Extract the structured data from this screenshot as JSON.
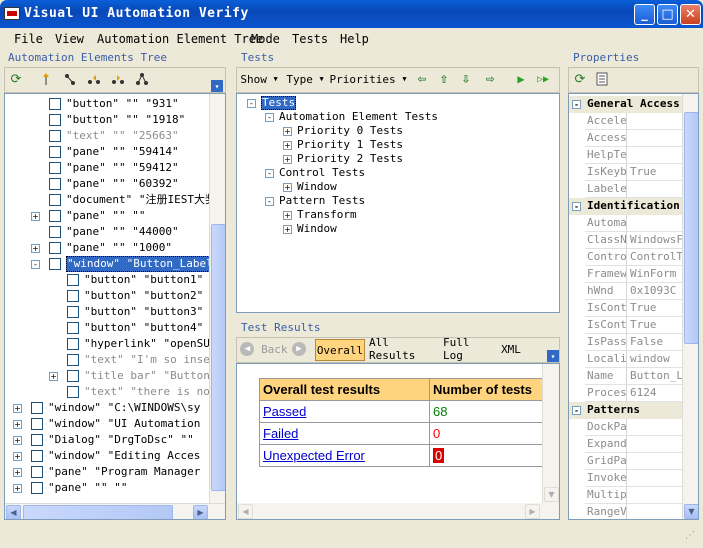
{
  "window": {
    "title": "Visual UI Automation Verify",
    "min": "_",
    "max": "□",
    "close": "✕"
  },
  "menu": [
    "File",
    "View",
    "Automation Element Tree",
    "Mode",
    "Tests",
    "Help"
  ],
  "tree_pane": {
    "title": "Automation Elements Tree",
    "rows": [
      {
        "text": "\"button\" \"\" \"931\"",
        "indent": 1,
        "expander": "",
        "gray": false,
        "selected": false
      },
      {
        "text": "\"button\" \"\" \"1918\"",
        "indent": 1,
        "expander": "",
        "gray": false,
        "selected": false
      },
      {
        "text": "\"text\" \"\" \"25663\"",
        "indent": 1,
        "expander": "",
        "gray": true,
        "selected": false
      },
      {
        "text": "\"pane\" \"\" \"59414\"",
        "indent": 1,
        "expander": "",
        "gray": false,
        "selected": false
      },
      {
        "text": "\"pane\" \"\" \"59412\"",
        "indent": 1,
        "expander": "",
        "gray": false,
        "selected": false
      },
      {
        "text": "\"pane\" \"\" \"60392\"",
        "indent": 1,
        "expander": "",
        "gray": false,
        "selected": false
      },
      {
        "text": "\"document\" \"注册IEST大奖",
        "indent": 1,
        "expander": "",
        "gray": false,
        "selected": false
      },
      {
        "text": "\"pane\" \"\" \"\"",
        "indent": 1,
        "expander": "+",
        "gray": false,
        "selected": false
      },
      {
        "text": "\"pane\" \"\" \"44000\"",
        "indent": 1,
        "expander": "",
        "gray": false,
        "selected": false
      },
      {
        "text": "\"pane\" \"\" \"1000\"",
        "indent": 1,
        "expander": "+",
        "gray": false,
        "selected": false
      },
      {
        "text": "\"window\" \"Button_Label_",
        "indent": 1,
        "expander": "-",
        "gray": false,
        "selected": true
      },
      {
        "text": "\"button\" \"button1\" \"",
        "indent": 2,
        "expander": "",
        "gray": false,
        "selected": false
      },
      {
        "text": "\"button\" \"button2\" \"",
        "indent": 2,
        "expander": "",
        "gray": false,
        "selected": false
      },
      {
        "text": "\"button\" \"button3\" \"",
        "indent": 2,
        "expander": "",
        "gray": false,
        "selected": false
      },
      {
        "text": "\"button\" \"button4\" \"",
        "indent": 2,
        "expander": "",
        "gray": false,
        "selected": false
      },
      {
        "text": "\"hyperlink\" \"openSUS",
        "indent": 2,
        "expander": "",
        "gray": false,
        "selected": false
      },
      {
        "text": "\"text\" \"I'm so insen",
        "indent": 2,
        "expander": "",
        "gray": true,
        "selected": false
      },
      {
        "text": "\"title bar\" \"Button_",
        "indent": 2,
        "expander": "+",
        "gray": true,
        "selected": false
      },
      {
        "text": "\"text\" \"there is not",
        "indent": 2,
        "expander": "",
        "gray": true,
        "selected": false
      },
      {
        "text": "\"window\" \"C:\\WINDOWS\\sy",
        "indent": 0,
        "expander": "+",
        "gray": false,
        "selected": false
      },
      {
        "text": "\"window\" \"UI Automation",
        "indent": 0,
        "expander": "+",
        "gray": false,
        "selected": false
      },
      {
        "text": "\"Dialog\" \"DrgToDsc\" \"\"",
        "indent": 0,
        "expander": "+",
        "gray": false,
        "selected": false
      },
      {
        "text": "\"window\" \"Editing Acces",
        "indent": 0,
        "expander": "+",
        "gray": false,
        "selected": false
      },
      {
        "text": "\"pane\" \"Program Manager",
        "indent": 0,
        "expander": "+",
        "gray": false,
        "selected": false
      },
      {
        "text": "\"pane\" \"\" \"\"",
        "indent": 0,
        "expander": "+",
        "gray": false,
        "selected": false
      }
    ]
  },
  "tests_pane": {
    "title": "Tests",
    "toolbar": {
      "show": "Show",
      "type": "Type",
      "priorities": "Priorities"
    },
    "tree": [
      {
        "label": "Tests",
        "level": 0,
        "expander": "-",
        "selected": true
      },
      {
        "label": "Automation Element Tests",
        "level": 1,
        "expander": "-",
        "selected": false
      },
      {
        "label": "Priority 0 Tests",
        "level": 2,
        "expander": "+",
        "selected": false
      },
      {
        "label": "Priority 1 Tests",
        "level": 2,
        "expander": "+",
        "selected": false
      },
      {
        "label": "Priority 2 Tests",
        "level": 2,
        "expander": "+",
        "selected": false
      },
      {
        "label": "Control Tests",
        "level": 1,
        "expander": "-",
        "selected": false
      },
      {
        "label": "Window",
        "level": 2,
        "expander": "+",
        "selected": false
      },
      {
        "label": "Pattern Tests",
        "level": 1,
        "expander": "-",
        "selected": false
      },
      {
        "label": "Transform",
        "level": 2,
        "expander": "+",
        "selected": false
      },
      {
        "label": "Window",
        "level": 2,
        "expander": "+",
        "selected": false
      }
    ]
  },
  "results_pane": {
    "title": "Test Results",
    "back": "Back",
    "tabs": [
      "Overall",
      "All Results",
      "Full Log",
      "XML"
    ],
    "table": {
      "headers": [
        "Overall test results",
        "Number of tests"
      ],
      "rows": [
        {
          "label": "Passed",
          "count": "68"
        },
        {
          "label": "Failed",
          "count": "0"
        },
        {
          "label": "Unexpected Error",
          "count": "0"
        }
      ]
    }
  },
  "properties_pane": {
    "title": "Properties",
    "sections": [
      {
        "name": "General Access",
        "rows": [
          {
            "name": "Acceler",
            "value": ""
          },
          {
            "name": "AccessK",
            "value": ""
          },
          {
            "name": "HelpTex",
            "value": ""
          },
          {
            "name": "IsKeybo",
            "value": "True"
          },
          {
            "name": "LabeledI",
            "value": ""
          }
        ]
      },
      {
        "name": "Identification",
        "rows": [
          {
            "name": "Automati",
            "value": ""
          },
          {
            "name": "ClassNa",
            "value": "WindowsFo"
          },
          {
            "name": "ControlT",
            "value": "ControlTy"
          },
          {
            "name": "Framew",
            "value": "WinForm"
          },
          {
            "name": "hWnd",
            "value": "0x1093C"
          },
          {
            "name": "IsContr",
            "value": "True"
          },
          {
            "name": "IsConte",
            "value": "True"
          },
          {
            "name": "IsPassw",
            "value": "False"
          },
          {
            "name": "Localiz",
            "value": "window"
          },
          {
            "name": "Name",
            "value": "Button_La"
          },
          {
            "name": "Process",
            "value": "6124"
          }
        ]
      },
      {
        "name": "Patterns",
        "rows": [
          {
            "name": "DockPat",
            "value": ""
          },
          {
            "name": "ExpandC",
            "value": ""
          },
          {
            "name": "GridPatt",
            "value": ""
          },
          {
            "name": "InvokeP",
            "value": ""
          },
          {
            "name": "Multiple",
            "value": ""
          },
          {
            "name": "RangeV",
            "value": ""
          }
        ]
      }
    ]
  },
  "colors": {
    "accent": "#316ac5",
    "passed": "#008000",
    "failed": "#ff0000",
    "error_bg": "#dd0000",
    "header_bg": "#ffd47f"
  }
}
